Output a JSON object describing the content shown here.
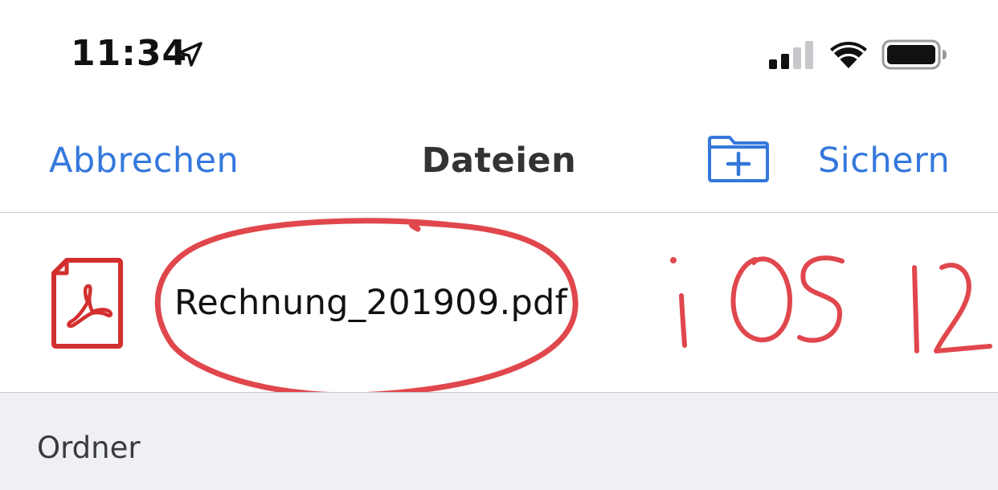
{
  "status_bar": {
    "time": "11:34",
    "icons": [
      "location-arrow-icon",
      "cellular-signal-icon",
      "wifi-icon",
      "battery-icon"
    ]
  },
  "nav": {
    "cancel_label": "Abbrechen",
    "title": "Dateien",
    "new_folder_icon": "folder-plus-icon",
    "save_label": "Sichern"
  },
  "file": {
    "icon": "pdf-file-icon",
    "name": "Rechnung_201909.pdf"
  },
  "annotation": {
    "text": "iOS 12"
  },
  "section": {
    "label": "Ordner"
  },
  "colors": {
    "accent": "#3478dc",
    "pdf_red": "#d32f2f",
    "annotation_red": "#e0474c",
    "section_bg": "#eef0f3"
  }
}
